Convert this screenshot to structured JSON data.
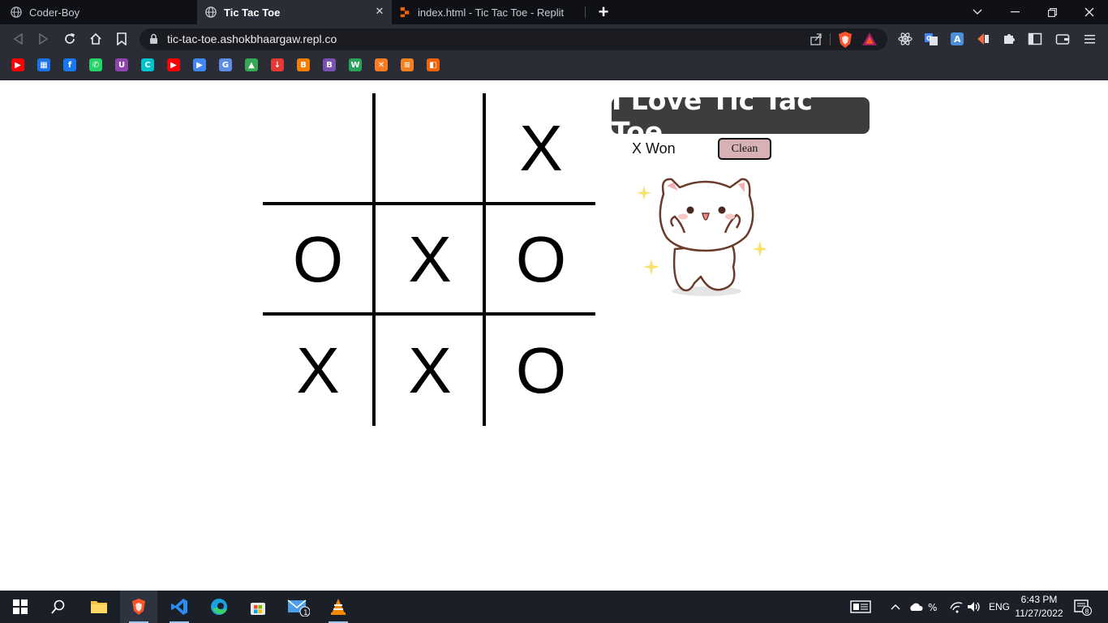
{
  "browser": {
    "tabs": [
      {
        "title": "Coder-Boy",
        "active": false
      },
      {
        "title": "Tic Tac Toe",
        "active": true
      },
      {
        "title": "index.html - Tic Tac Toe - Replit",
        "active": false
      }
    ],
    "new_tab_label": "+",
    "address": "tic-tac-toe.ashokbhaargaw.repl.co"
  },
  "bookmarks": [
    {
      "icon": "youtube-icon",
      "color": "#ff0000",
      "glyph": "▶"
    },
    {
      "icon": "calendar-icon",
      "color": "#1a73e8",
      "glyph": "▦"
    },
    {
      "icon": "facebook-icon",
      "color": "#1877f2",
      "glyph": "f"
    },
    {
      "icon": "whatsapp-icon",
      "color": "#25d366",
      "glyph": "✆"
    },
    {
      "icon": "u-app-icon",
      "color": "#8e44ad",
      "glyph": "U"
    },
    {
      "icon": "canva-icon",
      "color": "#00c4cc",
      "glyph": "C"
    },
    {
      "icon": "youtube-icon",
      "color": "#ff0000",
      "glyph": "▶"
    },
    {
      "icon": "media-icon",
      "color": "#4285f4",
      "glyph": "▶"
    },
    {
      "icon": "translate-icon",
      "color": "#5c8ee6",
      "glyph": "G"
    },
    {
      "icon": "drive-icon",
      "color": "#34a853",
      "glyph": "▲"
    },
    {
      "icon": "download-icon",
      "color": "#e53935",
      "glyph": "↓"
    },
    {
      "icon": "blogger-icon",
      "color": "#f57d00",
      "glyph": "B"
    },
    {
      "icon": "bootstrap-icon",
      "color": "#7952b3",
      "glyph": "B"
    },
    {
      "icon": "w-app-icon",
      "color": "#2aa35a",
      "glyph": "W"
    },
    {
      "icon": "xampp-icon",
      "color": "#fb7a24",
      "glyph": "✕"
    },
    {
      "icon": "stackoverflow-icon",
      "color": "#f48024",
      "glyph": "≡"
    },
    {
      "icon": "replit-icon",
      "color": "#f26207",
      "glyph": "◧"
    }
  ],
  "game": {
    "heading": "I Love Tic Tac Toe",
    "status": "X Won",
    "clean_label": "Clean",
    "cells": [
      "",
      "",
      "X",
      "O",
      "X",
      "O",
      "X",
      "X",
      "O"
    ]
  },
  "taskbar": {
    "language": "ENG",
    "time": "6:43 PM",
    "date": "11/27/2022",
    "mail_badge": "1",
    "notification_count": "8"
  }
}
